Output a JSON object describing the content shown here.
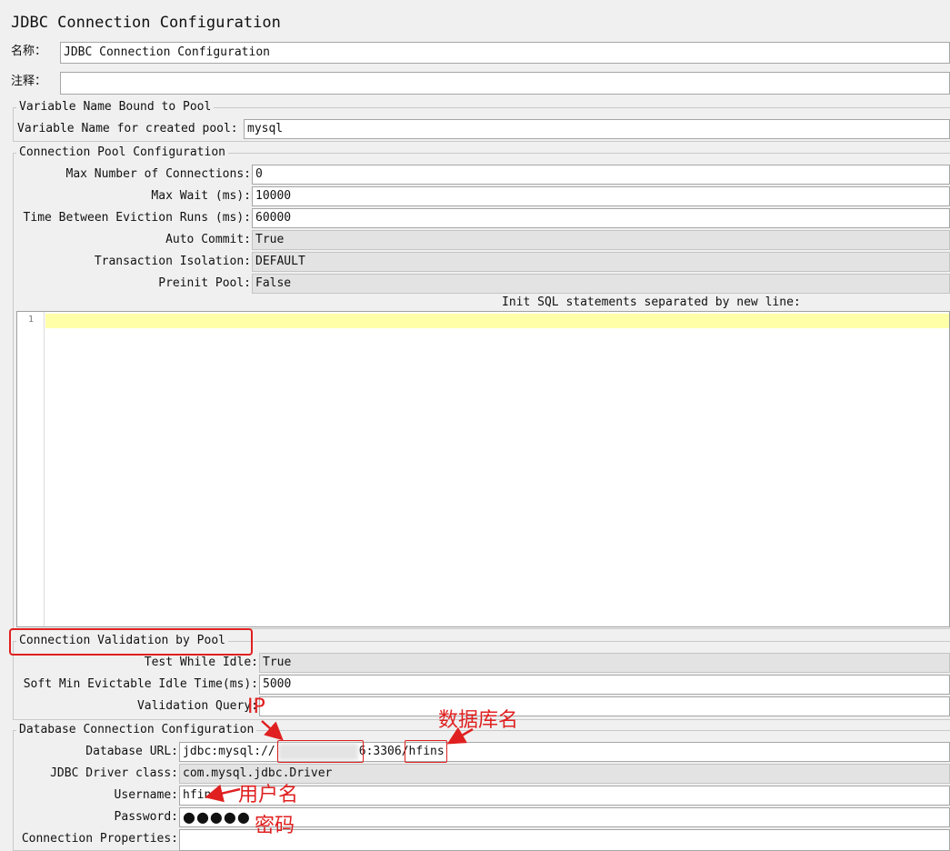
{
  "title": "JDBC Connection Configuration",
  "name_field": {
    "label": "名称：",
    "value": "JDBC Connection Configuration"
  },
  "comment_field": {
    "label": "注释：",
    "value": ""
  },
  "variable_group": {
    "legend": "Variable Name Bound to Pool",
    "label": "Variable Name for created pool:",
    "value": "mysql"
  },
  "pool_group": {
    "legend": "Connection Pool Configuration",
    "max_connections": {
      "label": "Max Number of Connections:",
      "value": "0"
    },
    "max_wait": {
      "label": "Max Wait (ms):",
      "value": "10000"
    },
    "eviction_runs": {
      "label": "Time Between Eviction Runs (ms):",
      "value": "60000"
    },
    "auto_commit": {
      "label": "Auto Commit:",
      "value": "True"
    },
    "transaction_isolation": {
      "label": "Transaction Isolation:",
      "value": "DEFAULT"
    },
    "preinit_pool": {
      "label": "Preinit Pool:",
      "value": "False"
    },
    "init_sql_label": "Init SQL statements separated by new line:",
    "editor_line_number": "1"
  },
  "validation_group": {
    "legend": "Connection Validation by Pool",
    "test_while_idle": {
      "label": "Test While Idle:",
      "value": "True"
    },
    "soft_min_evictable": {
      "label": "Soft Min Evictable Idle Time(ms):",
      "value": "5000"
    },
    "validation_query": {
      "label": "Validation Query:",
      "value": ""
    }
  },
  "database_group": {
    "legend": "Database Connection Configuration",
    "url": {
      "label": "Database URL:",
      "prefix": "jdbc:mysql://",
      "port_part": "6:3306/",
      "db_name": "hfins"
    },
    "driver": {
      "label": "JDBC Driver class:",
      "value": "com.mysql.jdbc.Driver"
    },
    "username": {
      "label": "Username:",
      "value": "hfins"
    },
    "password": {
      "label": "Password:",
      "value": "●●●●●"
    },
    "connection_properties": {
      "label": "Connection Properties:",
      "value": ""
    }
  },
  "annotations": {
    "ip": "IP",
    "db_name": "数据库名",
    "username": "用户名",
    "password": "密码"
  },
  "colors": {
    "annotation": "#e02020",
    "highlight_line": "#ffffa8"
  }
}
